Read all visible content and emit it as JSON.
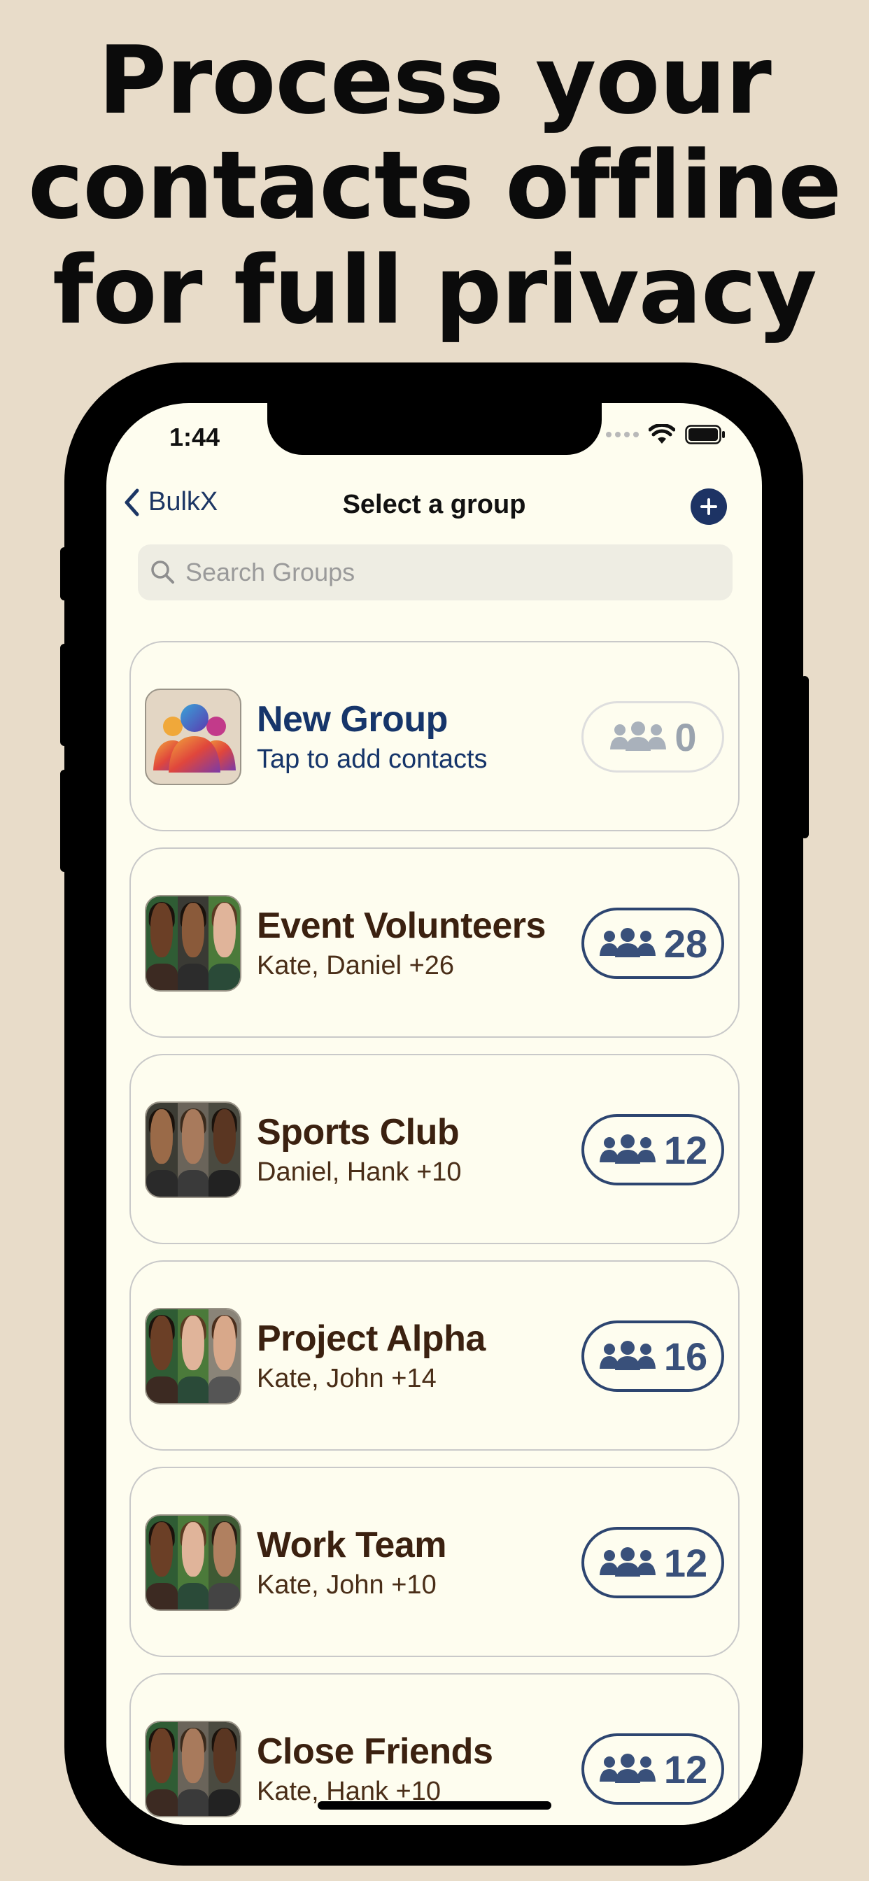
{
  "headline": {
    "line1": "Process your",
    "line2": "contacts offline",
    "line3": "for full privacy"
  },
  "status_bar": {
    "time": "1:44"
  },
  "nav": {
    "back_label": "BulkX",
    "title": "Select a group"
  },
  "search": {
    "placeholder": "Search Groups"
  },
  "groups": [
    {
      "title": "New Group",
      "subtitle": "Tap to add contacts",
      "count": "0"
    },
    {
      "title": "Event Volunteers",
      "subtitle": "Kate, Daniel +26",
      "count": "28"
    },
    {
      "title": "Sports Club",
      "subtitle": "Daniel, Hank +10",
      "count": "12"
    },
    {
      "title": "Project Alpha",
      "subtitle": "Kate, John +14",
      "count": "16"
    },
    {
      "title": "Work Team",
      "subtitle": "Kate, John +10",
      "count": "12"
    },
    {
      "title": "Close Friends",
      "subtitle": "Kate, Hank +10",
      "count": "12"
    }
  ],
  "colors": {
    "background": "#e8dcc9",
    "screen": "#fefdef",
    "accent_navy": "#1d3364",
    "title_brown": "#3b2110"
  },
  "icons": {
    "back": "chevron-left-icon",
    "add": "plus-circle-icon",
    "search": "magnifier-icon",
    "members": "people-group-icon"
  }
}
